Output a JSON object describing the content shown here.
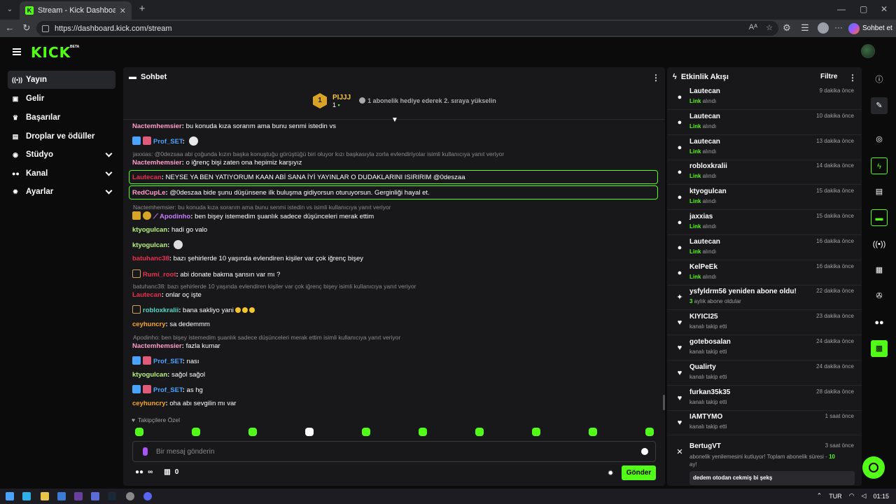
{
  "browser": {
    "tab_title": "Stream - Kick Dashboard",
    "url": "https://dashboard.kick.com/stream",
    "copilot_label": "Sohbet et"
  },
  "app": {
    "logo": "KICK",
    "beta": "BETA",
    "accent_color": "#53fc18"
  },
  "sidebar": {
    "items": [
      {
        "label": "Yayın",
        "icon": "broadcast-icon",
        "active": true
      },
      {
        "label": "Gelir",
        "icon": "money-icon"
      },
      {
        "label": "Başarılar",
        "icon": "trophy-icon"
      },
      {
        "label": "Droplar ve ödüller",
        "icon": "gift-icon"
      },
      {
        "label": "Stüdyo",
        "icon": "gamepad-icon",
        "expandable": true
      },
      {
        "label": "Kanal",
        "icon": "people-icon",
        "expandable": true
      },
      {
        "label": "Ayarlar",
        "icon": "gear-icon",
        "expandable": true
      }
    ]
  },
  "chat": {
    "title": "Sohbet",
    "pinned": {
      "rank": "1",
      "name": "PIJJJ",
      "count": "1",
      "cta": "1 abonelik hediye ederek 2. sıraya yükselin"
    },
    "messages": [
      {
        "user": "Nactemhemsier",
        "color": "#ff9ec8",
        "text": "bu konuda kıza sorarım ama bunu senmi istedin vs"
      },
      {
        "user": "Prof_SET",
        "color": "#4aa3ff",
        "text": ""
      },
      {
        "reply": "jaxxias: @0dezsaa abi çoğunda kızın başka konuştuğu görüştüğü biri oluyor kızı başkasıyla zorla evlendiriyolar isimli kullanıcıya yanıt veriyor"
      },
      {
        "user": "Nactemhemsier",
        "color": "#ff9ec8",
        "text": "o iğrenç bişi zaten ona hepimiz karşıyız"
      },
      {
        "user": "Lautecan",
        "color": "#e8304e",
        "text": "NEYSE YA BEN YATIYORUM KAAN ABİ SANA İYİ YAYINLAR O DUDAKLARINI ISIRIRIM @0deszaa"
      },
      {
        "user": "RedCupLe",
        "color": "#ff9ec8",
        "text": "@0deszaa bide şunu düşünsene ilk buluşma gidiyorsun oturuyorsun. Gerginliği hayal et."
      },
      {
        "reply": "Nactemhemsier: bu konuda kıza sorarım ama bunu senmi istedin vs  isimli kullanıcıya yanıt veriyor"
      },
      {
        "user": "Apodinho",
        "color": "#c77dff",
        "text": "ben bişey istemedim şuanlık sadece düşünceleri merak ettim"
      },
      {
        "user": "ktyogulcan",
        "color": "#b9f27c",
        "text": "hadi go valo"
      },
      {
        "user": "ktyogulcan",
        "color": "#b9f27c",
        "text": ""
      },
      {
        "user": "batuhanc38",
        "color": "#e8304e",
        "text": "bazı şehirlerde 10 yaşında evlendiren kişiler var çok iğrenç bişey"
      },
      {
        "user": "Rumi_root",
        "color": "#e8304e",
        "text": "abi donate bakma şansın var mı ?"
      },
      {
        "reply": "batuhanc38: bazı şehirlerde 10 yaşında evlendiren kişiler var çok iğrenç bişey isimli kullanıcıya yanıt veriyor"
      },
      {
        "user": "Lautecan",
        "color": "#e8304e",
        "text": "onlar oç işte"
      },
      {
        "user": "robloxkralii",
        "color": "#53d9c8",
        "text": "bana sakliyo yani"
      },
      {
        "user": "ceyhuncry",
        "color": "#f5a623",
        "text": "sa dedemmm"
      },
      {
        "reply": "Apodinho: ben bişey istemedim şuanlık sadece düşünceleri merak ettim isimli kullanıcıya yanıt veriyor"
      },
      {
        "user": "Nactemhemsier",
        "color": "#ff9ec8",
        "text": "fazla kumar"
      },
      {
        "user": "Prof_SET",
        "color": "#4aa3ff",
        "text": "nası"
      },
      {
        "user": "ktyogulcan",
        "color": "#b9f27c",
        "text": "sağol sağol"
      },
      {
        "user": "Prof_SET",
        "color": "#4aa3ff",
        "text": "as hg"
      },
      {
        "user": "ceyhuncry",
        "color": "#f5a623",
        "text": "oha abı sevgilin mı var"
      }
    ],
    "followers_only": "Takipçilere Özel",
    "input_placeholder": "Bir mesaj gönderin",
    "infinity": "∞",
    "chest_count": "0",
    "send_label": "Gönder"
  },
  "activity": {
    "title": "Etkinlik Akışı",
    "filter": "Filtre",
    "items": [
      {
        "name": "Lautecan",
        "desc_prefix": "Link",
        "desc": " alındı",
        "time": "9 dakika önce",
        "icon": "link-icon"
      },
      {
        "name": "Lautecan",
        "desc_prefix": "Link",
        "desc": " alındı",
        "time": "10 dakika önce",
        "icon": "link-icon"
      },
      {
        "name": "Lautecan",
        "desc_prefix": "Link",
        "desc": " alındı",
        "time": "13 dakika önce",
        "icon": "link-icon"
      },
      {
        "name": "robloxkralii",
        "desc_prefix": "Link",
        "desc": " alındı",
        "time": "14 dakika önce",
        "icon": "link-icon"
      },
      {
        "name": "ktyogulcan",
        "desc_prefix": "Link",
        "desc": " alındı",
        "time": "15 dakika önce",
        "icon": "link-icon"
      },
      {
        "name": "jaxxias",
        "desc_prefix": "Link",
        "desc": " alındı",
        "time": "15 dakika önce",
        "icon": "link-icon"
      },
      {
        "name": "Lautecan",
        "desc_prefix": "Link",
        "desc": " alındı",
        "time": "16 dakika önce",
        "icon": "link-icon"
      },
      {
        "name": "KelPeEk",
        "desc_prefix": "Link",
        "desc": " alındı",
        "time": "16 dakika önce",
        "icon": "link-icon"
      },
      {
        "name": "ysfyldrm56 yeniden abone oldu!",
        "desc_prefix": "3",
        "desc": " aylık abone oldular",
        "time": "22 dakika önce",
        "icon": "sparkle-icon"
      },
      {
        "name": "KIYICI25",
        "desc_prefix": "",
        "desc": "kanalı takip etti",
        "time": "23 dakika önce",
        "icon": "heart-icon"
      },
      {
        "name": "gotebosalan",
        "desc_prefix": "",
        "desc": "kanalı takip etti",
        "time": "24 dakika önce",
        "icon": "heart-icon"
      },
      {
        "name": "Qualirty",
        "desc_prefix": "",
        "desc": "kanalı takip etti",
        "time": "24 dakika önce",
        "icon": "heart-icon"
      },
      {
        "name": "furkan35k35",
        "desc_prefix": "",
        "desc": "kanalı takip etti",
        "time": "28 dakika önce",
        "icon": "heart-icon"
      },
      {
        "name": "IAMTYMO",
        "desc_prefix": "",
        "desc": "kanalı takip etti",
        "time": "1 saat önce",
        "icon": "heart-icon"
      }
    ],
    "last": {
      "name": "BertugVT",
      "time": "3 saat önce",
      "desc": "abonelik yenilemesini kutluyor! Toplam abonelik süresi - ",
      "months": "10",
      "desc2": "ay!",
      "message": "dedem otodan cekmiş bi şekş"
    }
  },
  "taskbar": {
    "lang": "TUR",
    "clock": "01:15"
  }
}
